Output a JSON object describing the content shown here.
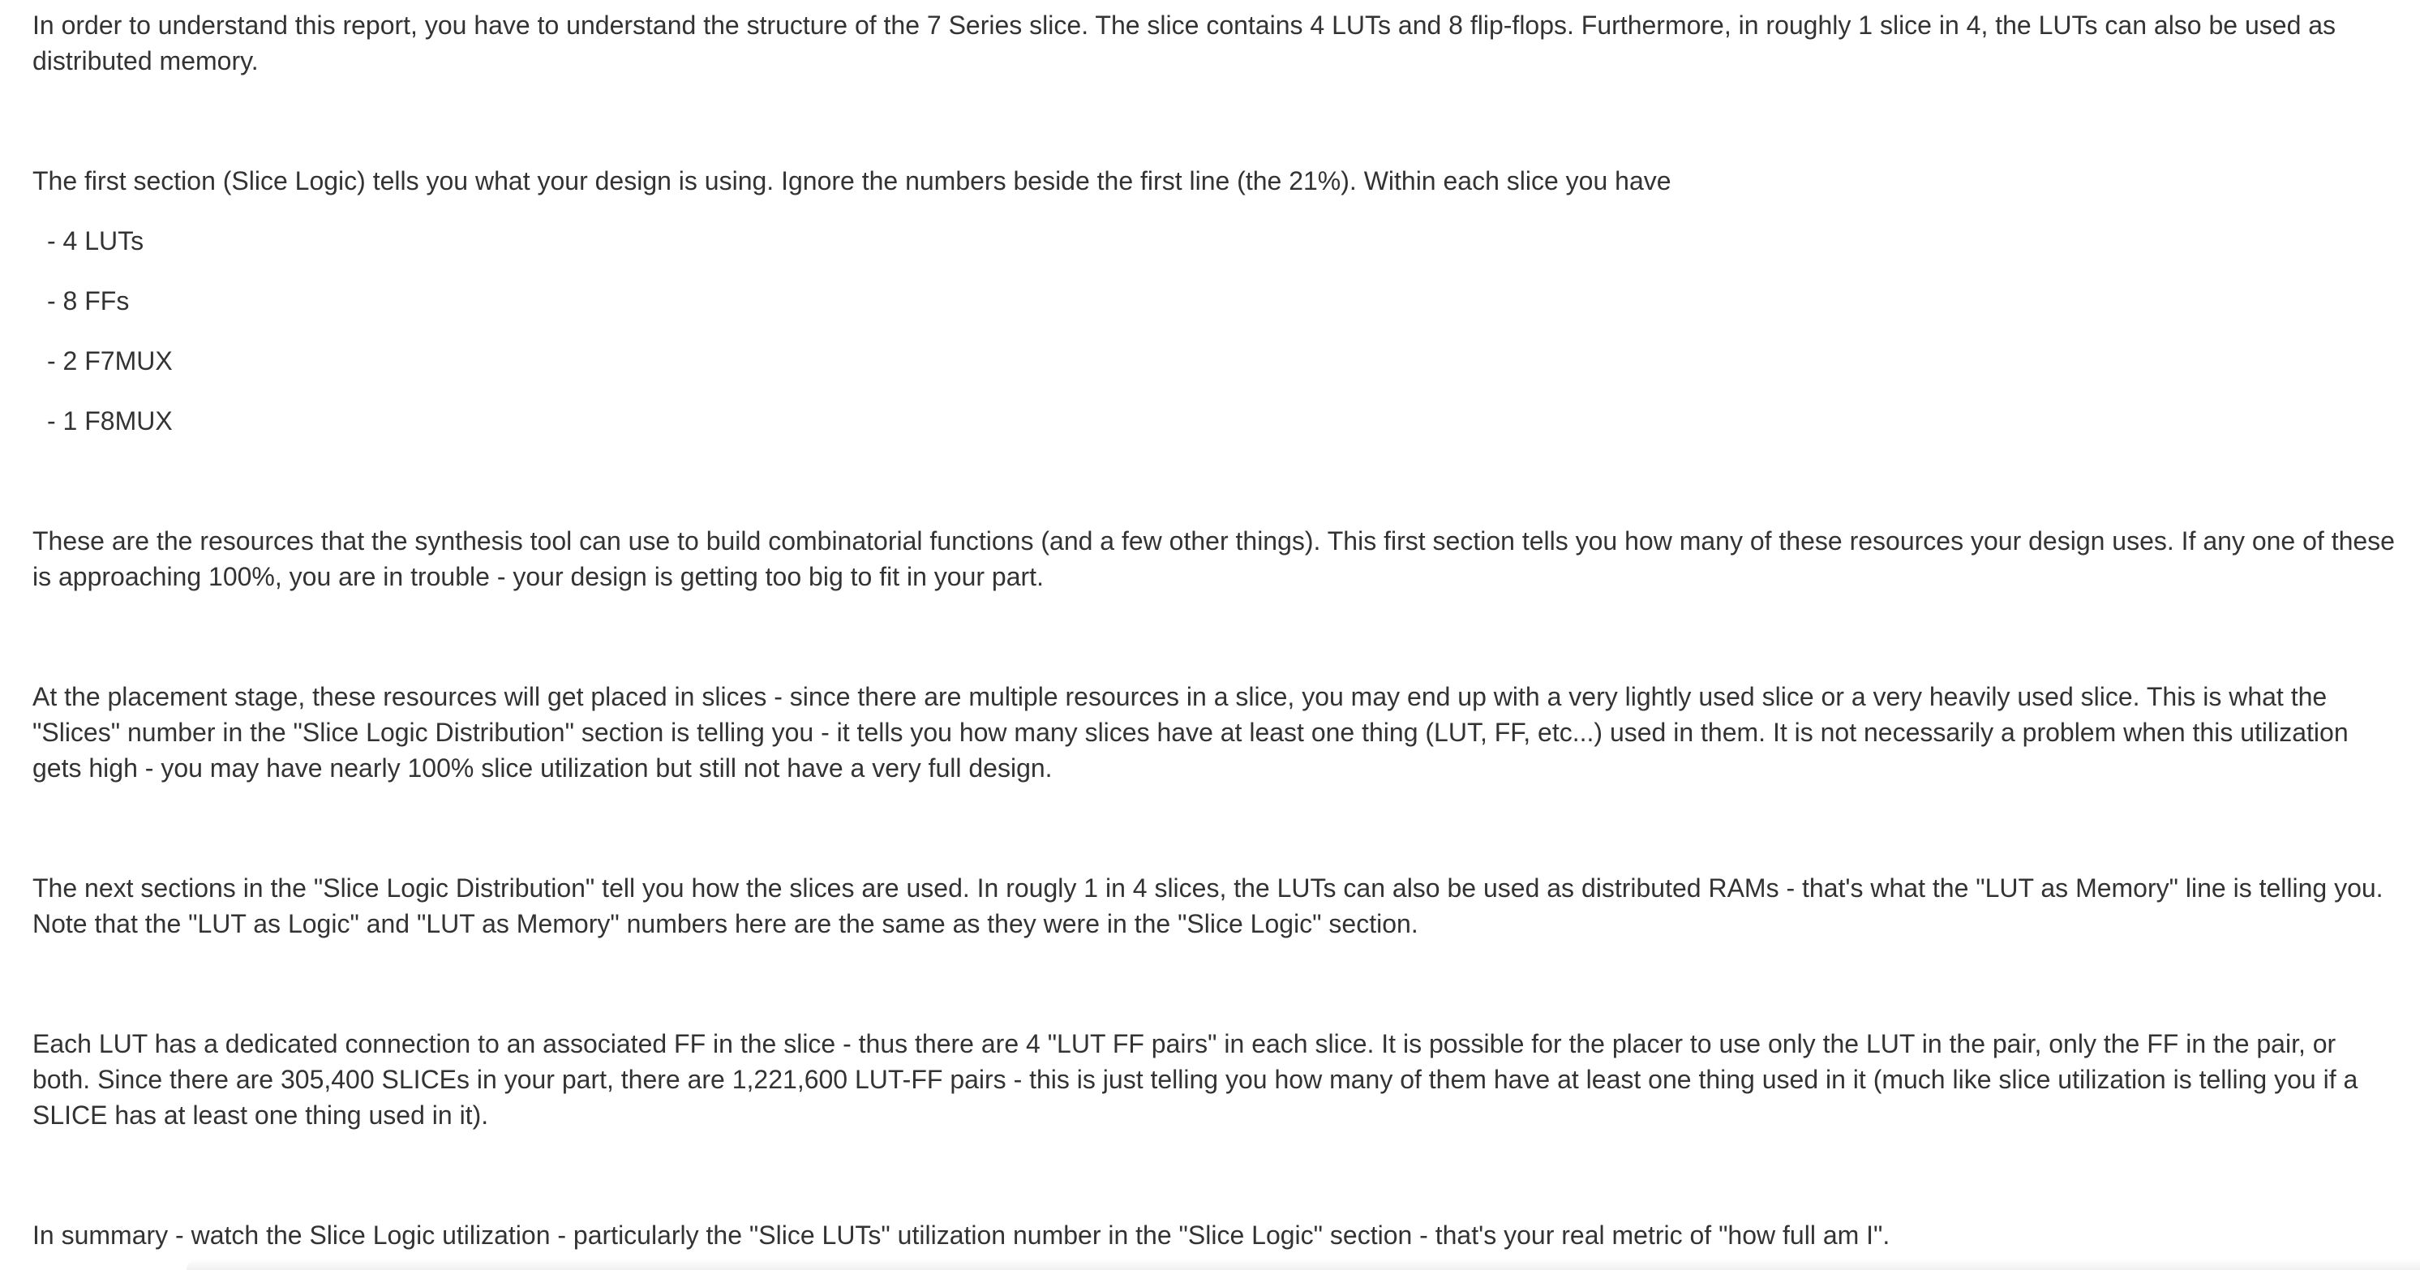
{
  "post": {
    "intro": "In order to understand this report, you have to understand the structure of the 7 Series slice. The slice contains 4 LUTs and 8 flip-flops. Furthermore, in roughly 1 slice in 4, the LUTs can also be used as distributed memory.",
    "first_section": "The first section (Slice Logic) tells you what your design is using. Ignore the numbers beside the first line (the 21%). Within each slice you have",
    "list": [
      "- 4 LUTs",
      "- 8 FFs",
      "- 2 F7MUX",
      "- 1 F8MUX"
    ],
    "resources": "These are the resources that the synthesis tool can use to build combinatorial functions (and a few other things). This first section tells you how many of these resources your design uses. If any one of these is approaching 100%, you are in trouble - your design is getting too big to fit in your part.",
    "placement": "At the placement stage, these resources  will get placed in slices - since there are multiple resources in a slice, you may end up with a very lightly used slice or a very heavily used slice. This is what the \"Slices\" number in the \"Slice Logic Distribution\" section is telling you - it tells you how many slices have at least one thing (LUT, FF, etc...) used in them. It is not necessarily a problem when this utilization gets high - you may have nearly 100% slice utilization but still not have a very full design.",
    "next_sections": "The next sections in the \"Slice Logic Distribution\" tell you how the slices are used. In rougly 1 in 4 slices, the LUTs can also be used as distributed RAMs - that's what the \"LUT as Memory\" line is telling you. Note that the \"LUT as Logic\" and \"LUT as Memory\" numbers here are the same as they were in the \"Slice Logic\" section.",
    "lut_ff": "Each LUT has a dedicated connection to an associated FF in the slice - thus there are 4 \"LUT FF pairs\" in each slice. It is possible for the placer to use only the LUT in the pair, only the FF in the pair, or both. Since there are 305,400 SLICEs in your part, there are 1,221,600 LUT-FF pairs - this is just telling you how many of them have at least one thing used in it (much like slice utilization is telling you if a SLICE has at least one thing used in it).",
    "summary": "In summary - watch the Slice Logic utilization - particularly the \"Slice LUTs\" utilization number in the \"Slice Logic\" section - that's your real metric of \"how full am I\"."
  }
}
